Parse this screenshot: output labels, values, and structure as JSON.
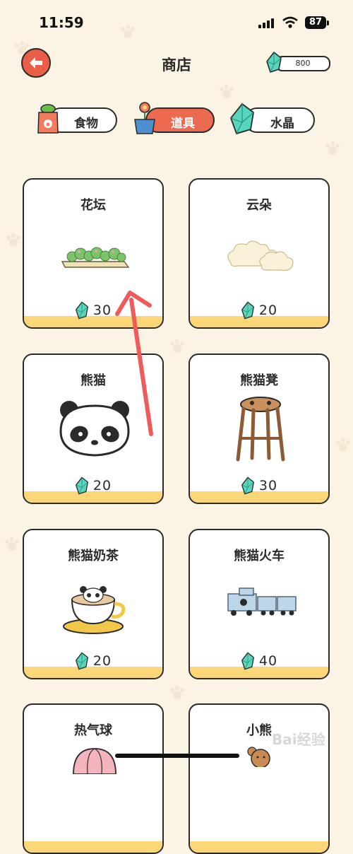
{
  "status_bar": {
    "time": "11:59",
    "battery": "87"
  },
  "header": {
    "title": "商店",
    "balance": "800"
  },
  "tabs": [
    {
      "label": "食物",
      "icon": "food-bag-icon",
      "active": false
    },
    {
      "label": "道具",
      "icon": "flower-pot-icon",
      "active": true
    },
    {
      "label": "水晶",
      "icon": "crystal-icon",
      "active": false
    }
  ],
  "items": [
    {
      "name": "花坛",
      "price": "30",
      "icon": "flower-bed-icon"
    },
    {
      "name": "云朵",
      "price": "20",
      "icon": "cloud-icon"
    },
    {
      "name": "熊猫",
      "price": "20",
      "icon": "panda-icon"
    },
    {
      "name": "熊猫凳",
      "price": "30",
      "icon": "stool-icon"
    },
    {
      "name": "熊猫奶茶",
      "price": "20",
      "icon": "milk-tea-icon"
    },
    {
      "name": "熊猫火车",
      "price": "40",
      "icon": "train-icon"
    },
    {
      "name": "热气球",
      "price": "",
      "icon": "hot-air-balloon-icon"
    },
    {
      "name": "小熊",
      "price": "",
      "icon": "bear-icon"
    }
  ],
  "colors": {
    "accent": "#ec6a4f",
    "background": "#fbf3e3",
    "card_bottom": "#fbd777",
    "gem": "#4fd1b5"
  },
  "watermark": "Bai经验"
}
